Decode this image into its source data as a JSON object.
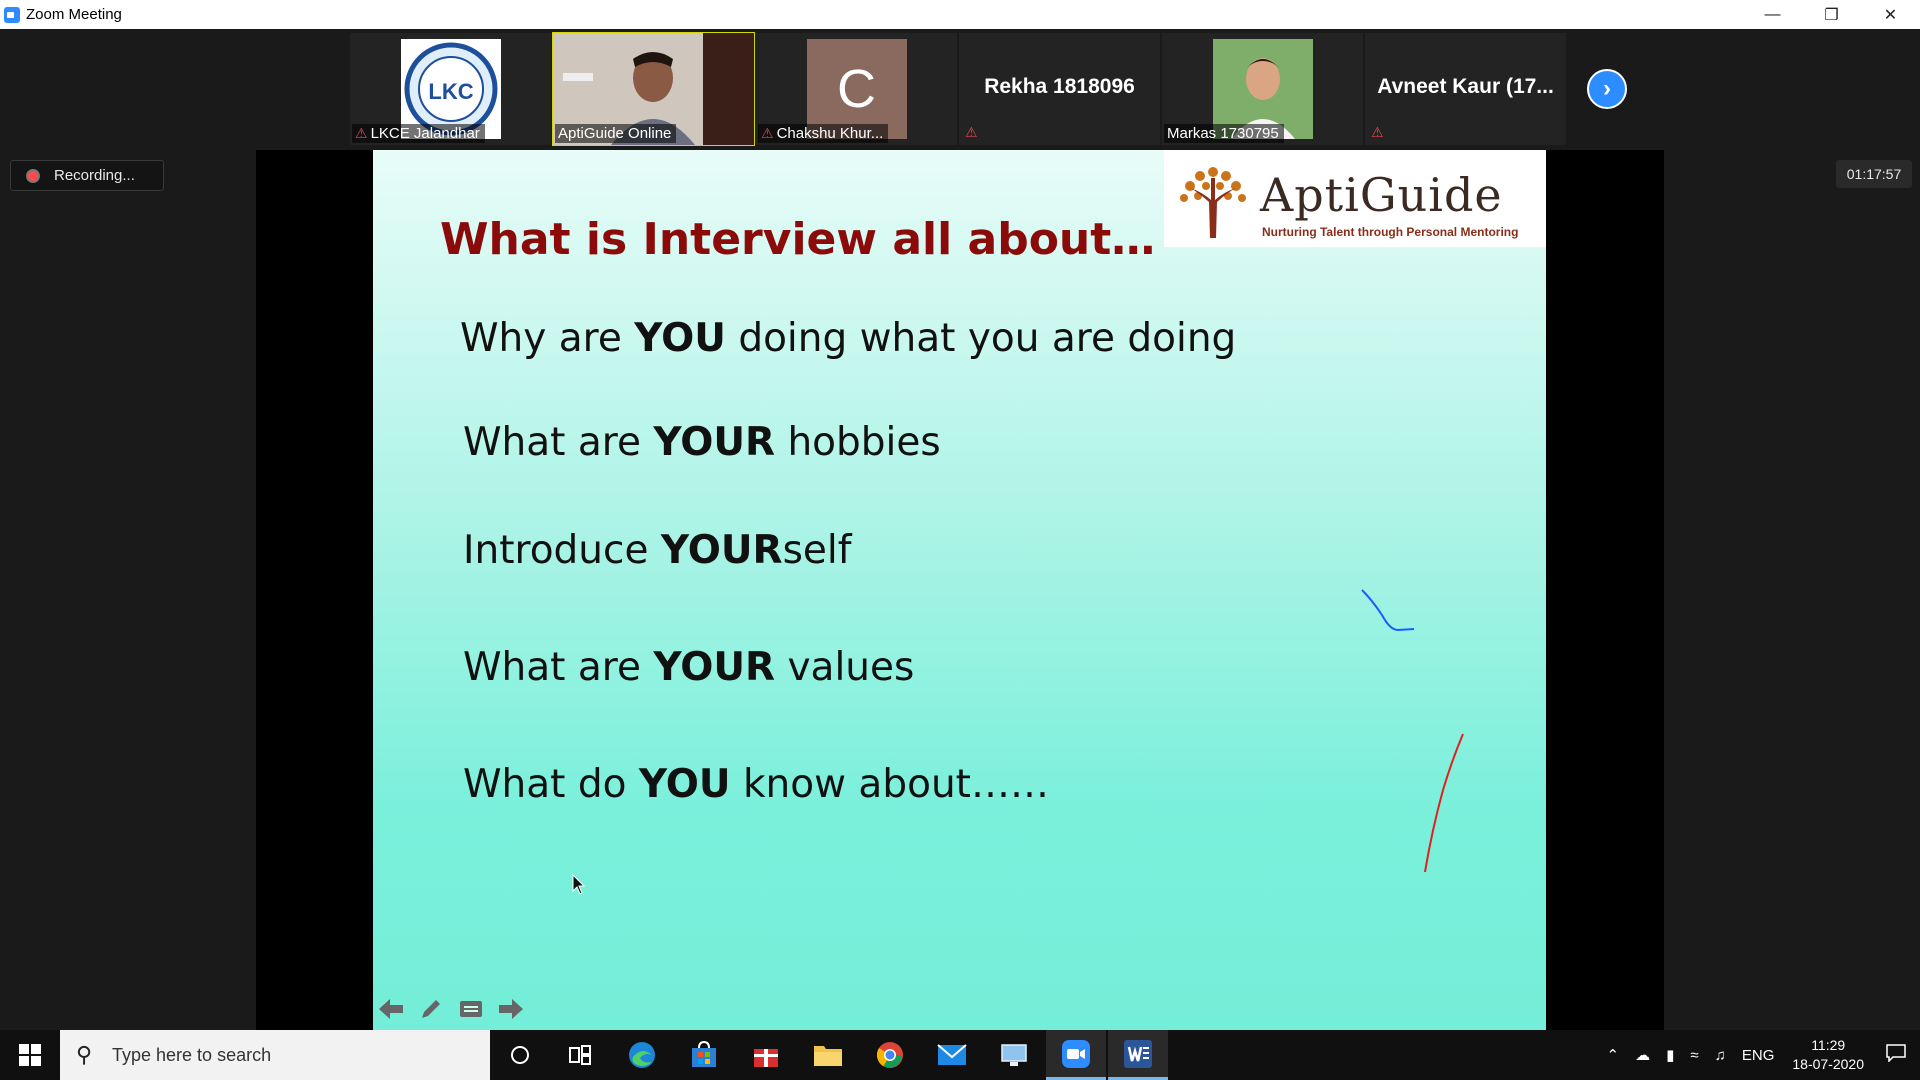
{
  "window": {
    "title": "Zoom Meeting"
  },
  "participants": [
    {
      "name": "LKCE Jalandhar",
      "muted": true,
      "type": "logo"
    },
    {
      "name": "AptiGuide Online",
      "muted": false,
      "type": "video",
      "active": true
    },
    {
      "name": "Chakshu Khur...",
      "muted": true,
      "type": "initial",
      "initial": "C"
    },
    {
      "name": "Rekha 1818096",
      "muted": true,
      "type": "name-only"
    },
    {
      "name": "Markas 1730795",
      "muted": false,
      "type": "photo"
    },
    {
      "name": "Avneet Kaur (17...",
      "muted": true,
      "type": "name-only"
    }
  ],
  "lkc_logo_text": "LKC",
  "recording": {
    "label": "Recording..."
  },
  "timer": "01:17:57",
  "slide": {
    "title": "What is Interview all about…",
    "logo": {
      "name": "AptiGuide",
      "tagline": "Nurturing Talent through Personal Mentoring"
    },
    "bullets": [
      {
        "pre": "Why are ",
        "bold": "YOU",
        "post": " doing what you are doing"
      },
      {
        "pre": "What are ",
        "bold": "YOUR",
        "post": " hobbies"
      },
      {
        "pre": "Introduce ",
        "bold": "YOUR",
        "post": "self"
      },
      {
        "pre": "What are ",
        "bold": "YOUR",
        "post": " values"
      },
      {
        "pre": "What do ",
        "bold": "YOU",
        "post": " know about……"
      }
    ]
  },
  "taskbar": {
    "search_placeholder": "Type here to search",
    "language": "ENG",
    "time": "11:29",
    "date": "18-07-2020"
  },
  "colors": {
    "zoom_blue": "#2d8cff",
    "slide_title": "#8b0b0b",
    "mute_red": "#e0484e"
  }
}
